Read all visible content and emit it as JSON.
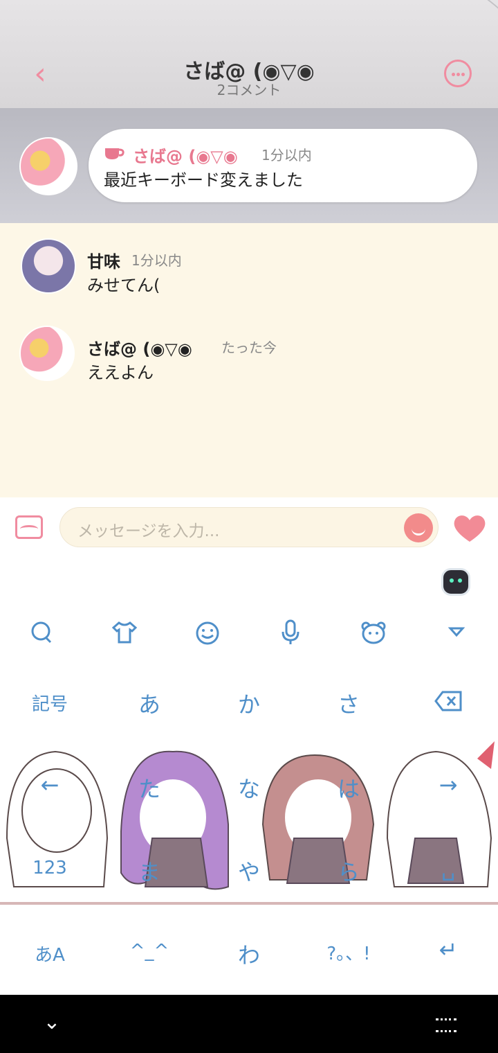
{
  "header": {
    "back_icon": "chevron-left-icon",
    "title": "さば@ (◉▽◉",
    "subtitle": "2コメント",
    "more_icon": "more-dots-icon"
  },
  "pinned": {
    "name": "さば@ (◉▽◉",
    "time": "1分以内",
    "text": "最近キーボード変えました"
  },
  "comments": [
    {
      "name": "甘味",
      "time": "1分以内",
      "text": "みせてん("
    },
    {
      "name": "さば@ (◉▽◉",
      "time": "たった今",
      "text": "ええよん"
    }
  ],
  "input": {
    "placeholder": "メッセージを入力..."
  },
  "keyboard": {
    "toolbar": [
      "search-icon",
      "shirt-icon",
      "smiley-icon",
      "mic-icon",
      "bear-icon",
      "collapse-icon"
    ],
    "row1": [
      "記号",
      "あ",
      "か",
      "さ",
      "⌫"
    ],
    "row2": [
      "←",
      "た",
      "な",
      "は",
      "→"
    ],
    "row3": [
      "123",
      "ま",
      "や",
      "ら",
      "␣"
    ],
    "row4": [
      "あA",
      "^_^",
      "わ",
      "?。、!",
      "↵"
    ]
  },
  "colors": {
    "accent": "#f08ca0",
    "comment_bg": "#fdf7e7",
    "key_blue": "#4f8fc9"
  }
}
